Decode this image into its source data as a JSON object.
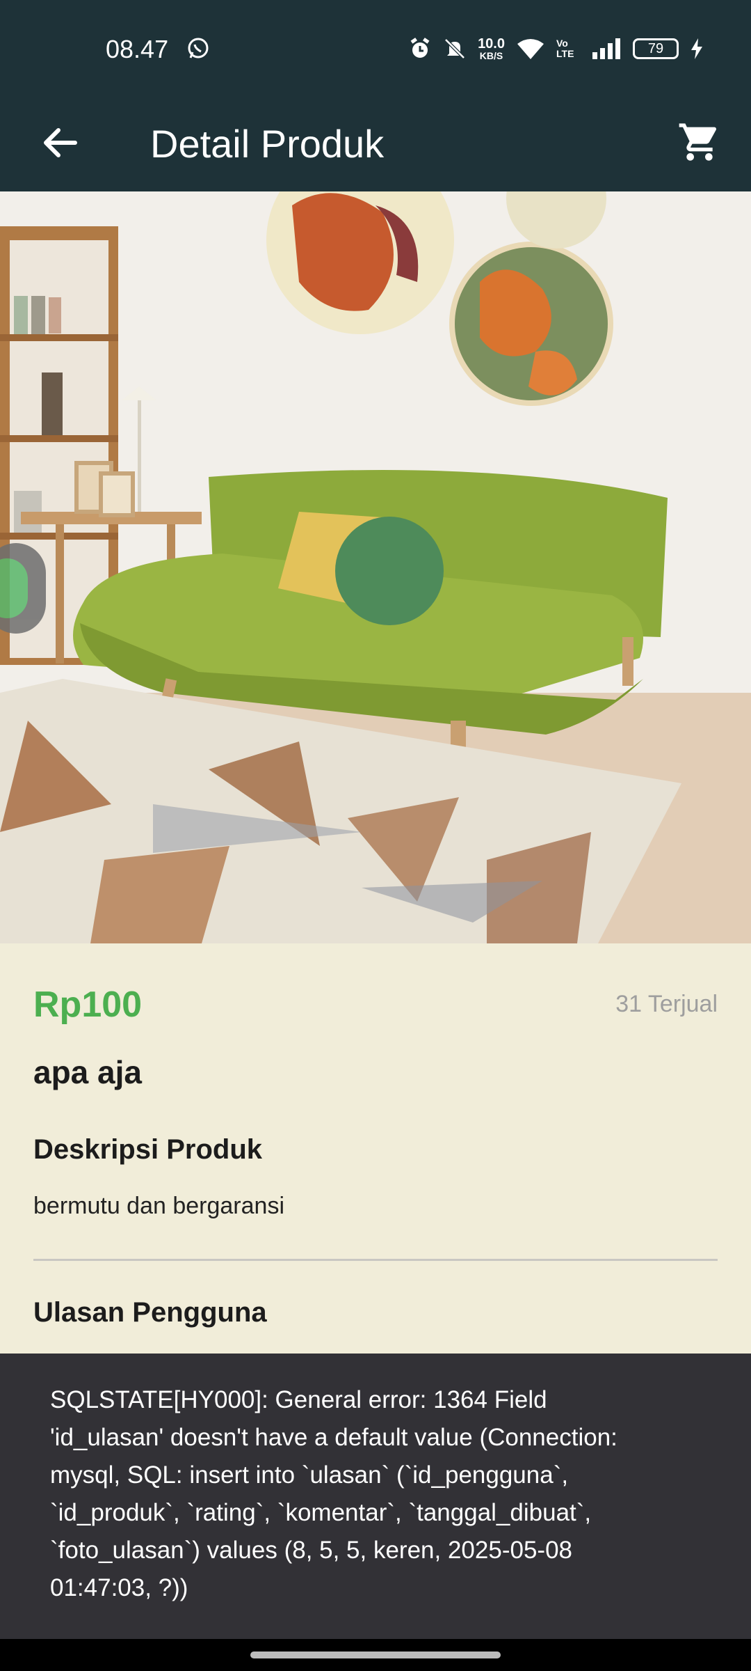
{
  "status_bar": {
    "time": "08.47",
    "net_speed_value": "10.0",
    "net_speed_unit": "KB/S",
    "volte": "Vo LTE",
    "battery": "79",
    "icons": [
      "whatsapp-icon",
      "alarm-icon",
      "mute-icon",
      "wifi-icon",
      "signal-icon",
      "battery-icon",
      "charging-icon"
    ]
  },
  "app_bar": {
    "title": "Detail Produk",
    "back_icon": "arrow-back-icon",
    "cart_icon": "shopping-cart-icon"
  },
  "product": {
    "price": "Rp100",
    "sold": "31 Terjual",
    "name": "apa aja",
    "description_title": "Deskripsi Produk",
    "description": "bermutu dan bergaransi",
    "reviews_title": "Ulasan Pengguna"
  },
  "snackbar": {
    "message": "SQLSTATE[HY000]: General error: 1364 Field\n'id_ulasan' doesn't have a default value (Connection:\nmysql, SQL: insert into `ulasan` (`id_pengguna`,\n`id_produk`, `rating`, `komentar`, `tanggal_dibuat`,\n`foto_ulasan`) values (8, 5, 5, keren, 2025-05-08\n01:47:03, ?))"
  },
  "colors": {
    "app_bar": "#1E3238",
    "background": "#F1EDD9",
    "price": "#4CAF50",
    "snackbar": "#323136"
  }
}
